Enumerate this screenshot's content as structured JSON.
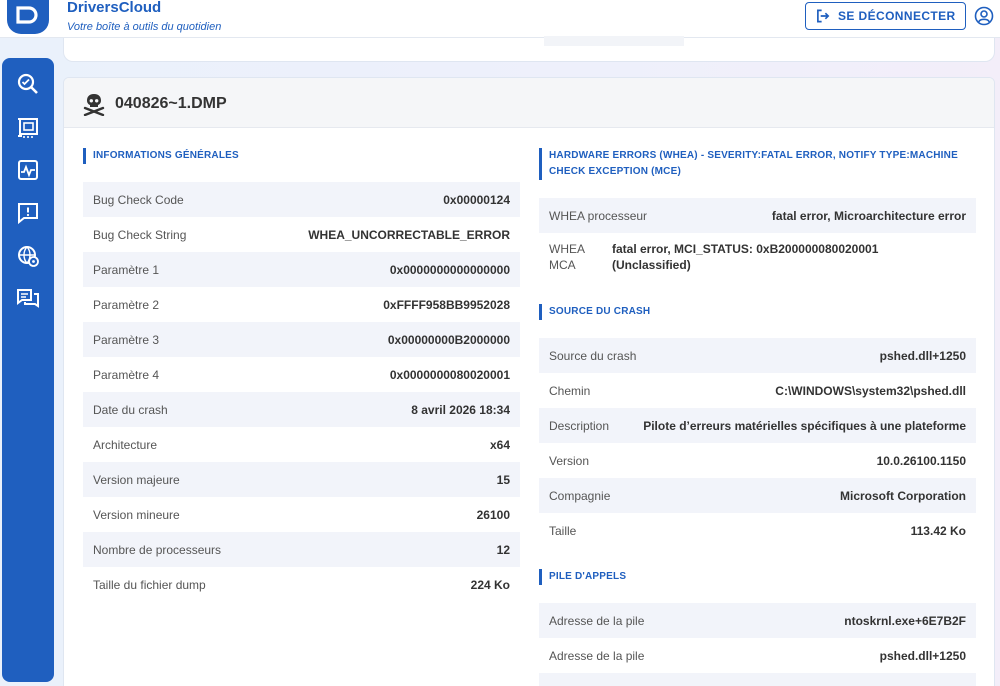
{
  "header": {
    "brand_title": "DriversCloud",
    "brand_subtitle": "Votre boîte à outils du quotidien",
    "logout_label": "SE DÉCONNECTER",
    "colors": {
      "brand": "#1f5fbf"
    }
  },
  "sidebar": {
    "items": [
      {
        "icon": "magnifier-scan-icon"
      },
      {
        "icon": "hardware-card-icon"
      },
      {
        "icon": "monitor-activity-icon"
      },
      {
        "icon": "chat-exclamation-icon"
      },
      {
        "icon": "globe-gear-icon"
      },
      {
        "icon": "chat-bubbles-icon"
      }
    ]
  },
  "card": {
    "title": "040826~1.DMP",
    "icon": "skull-crossbones-icon",
    "general": {
      "heading": "INFORMATIONS GÉNÉRALES",
      "rows": [
        {
          "label": "Bug Check Code",
          "value": "0x00000124"
        },
        {
          "label": "Bug Check String",
          "value": "WHEA_UNCORRECTABLE_ERROR"
        },
        {
          "label": "Paramètre 1",
          "value": "0x0000000000000000"
        },
        {
          "label": "Paramètre 2",
          "value": "0xFFFF958BB9952028"
        },
        {
          "label": "Paramètre 3",
          "value": "0x00000000B2000000"
        },
        {
          "label": "Paramètre 4",
          "value": "0x0000000080020001"
        },
        {
          "label": "Date du crash",
          "value": "8 avril 2026 18:34"
        },
        {
          "label": "Architecture",
          "value": "x64"
        },
        {
          "label": "Version majeure",
          "value": "15"
        },
        {
          "label": "Version mineure",
          "value": "26100"
        },
        {
          "label": "Nombre de processeurs",
          "value": "12"
        },
        {
          "label": "Taille du fichier dump",
          "value": "224 Ko"
        }
      ]
    },
    "whea": {
      "heading_line1": "HARDWARE ERRORS (WHEA) - SEVERITY:FATAL ERROR, NOTIFY TYPE:MACHINE",
      "heading_line2": "CHECK EXCEPTION (MCE)",
      "processor_label": "WHEA processeur",
      "processor_value": "fatal error, Microarchitecture error",
      "mca_label_line1": "WHEA",
      "mca_label_line2": "MCA",
      "mca_value_line1": "fatal error, MCI_STATUS: 0xB200000080020001",
      "mca_value_line2": "(Unclassified)"
    },
    "source": {
      "heading": "SOURCE DU CRASH",
      "rows": [
        {
          "label": "Source du crash",
          "value": "pshed.dll+1250"
        },
        {
          "label": "Chemin",
          "value": "C:\\WINDOWS\\system32\\pshed.dll"
        },
        {
          "label": "Description",
          "value": "Pilote d’erreurs matérielles spécifiques à une plateforme"
        },
        {
          "label": "Version",
          "value": "10.0.26100.1150"
        },
        {
          "label": "Compagnie",
          "value": "Microsoft Corporation"
        },
        {
          "label": "Taille",
          "value": "113.42 Ko"
        }
      ]
    },
    "stack": {
      "heading": "PILE D'APPELS",
      "rows": [
        {
          "label": "Adresse de la pile",
          "value": "ntoskrnl.exe+6E7B2F"
        },
        {
          "label": "Adresse de la pile",
          "value": "pshed.dll+1250"
        }
      ]
    }
  }
}
